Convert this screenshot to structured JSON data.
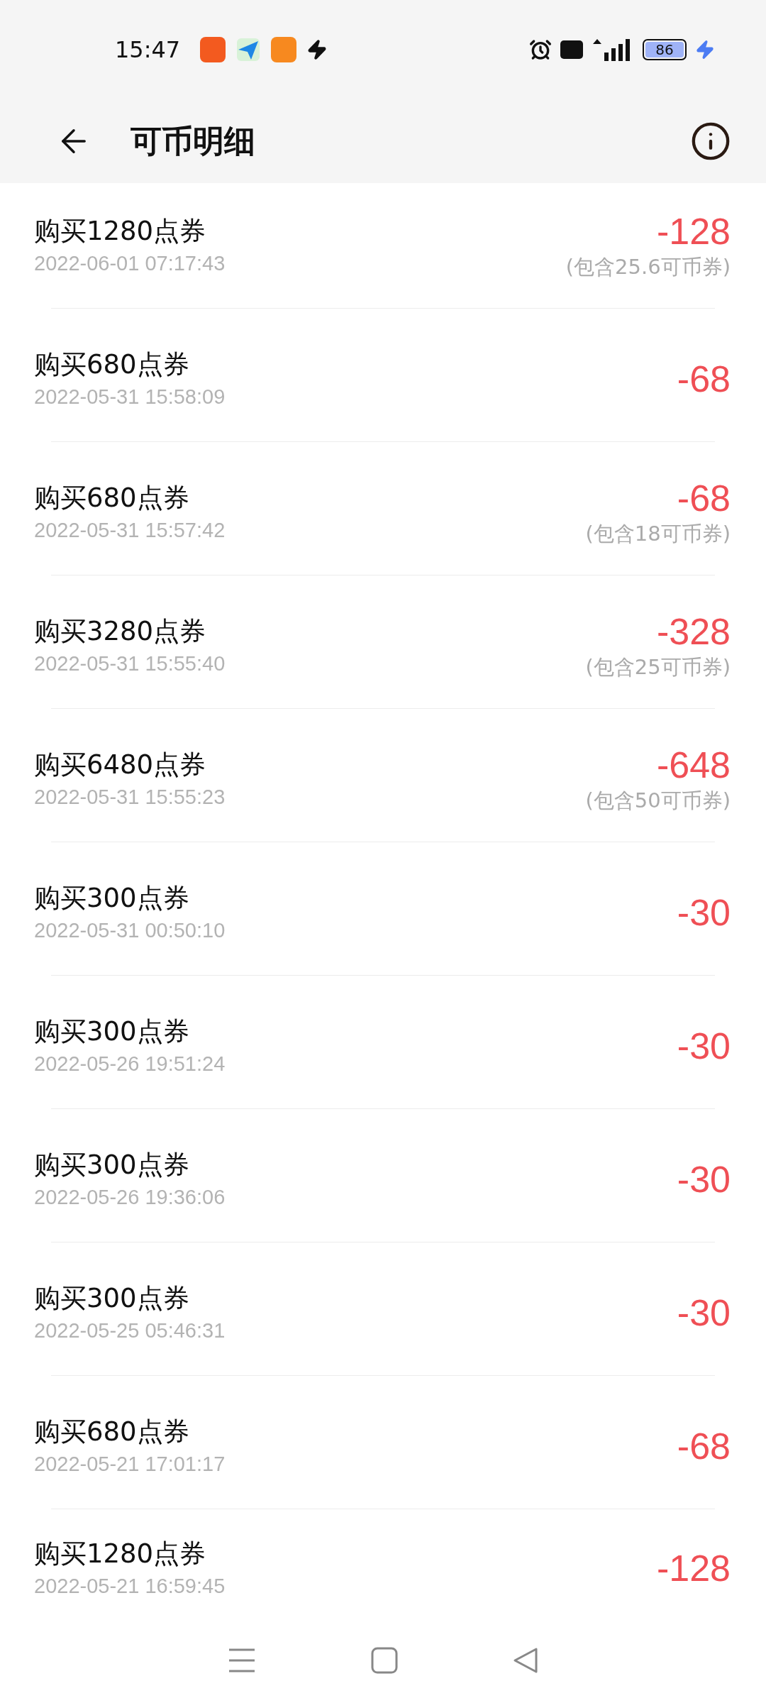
{
  "status_bar": {
    "time": "15:47",
    "battery": "86"
  },
  "header": {
    "title": "可币明细"
  },
  "records": [
    {
      "title": "购买1280点券",
      "time": "2022-06-01 07:17:43",
      "amount": "-128",
      "note": "(包含25.6可币券)"
    },
    {
      "title": "购买680点券",
      "time": "2022-05-31 15:58:09",
      "amount": "-68"
    },
    {
      "title": "购买680点券",
      "time": "2022-05-31 15:57:42",
      "amount": "-68",
      "note": "(包含18可币券)"
    },
    {
      "title": "购买3280点券",
      "time": "2022-05-31 15:55:40",
      "amount": "-328",
      "note": "(包含25可币券)"
    },
    {
      "title": "购买6480点券",
      "time": "2022-05-31 15:55:23",
      "amount": "-648",
      "note": "(包含50可币券)"
    },
    {
      "title": "购买300点券",
      "time": "2022-05-31 00:50:10",
      "amount": "-30"
    },
    {
      "title": "购买300点券",
      "time": "2022-05-26 19:51:24",
      "amount": "-30"
    },
    {
      "title": "购买300点券",
      "time": "2022-05-26 19:36:06",
      "amount": "-30"
    },
    {
      "title": "购买300点券",
      "time": "2022-05-25 05:46:31",
      "amount": "-30"
    },
    {
      "title": "购买680点券",
      "time": "2022-05-21 17:01:17",
      "amount": "-68"
    },
    {
      "title": "购买1280点券",
      "time": "2022-05-21 16:59:45",
      "amount": "-128"
    }
  ]
}
